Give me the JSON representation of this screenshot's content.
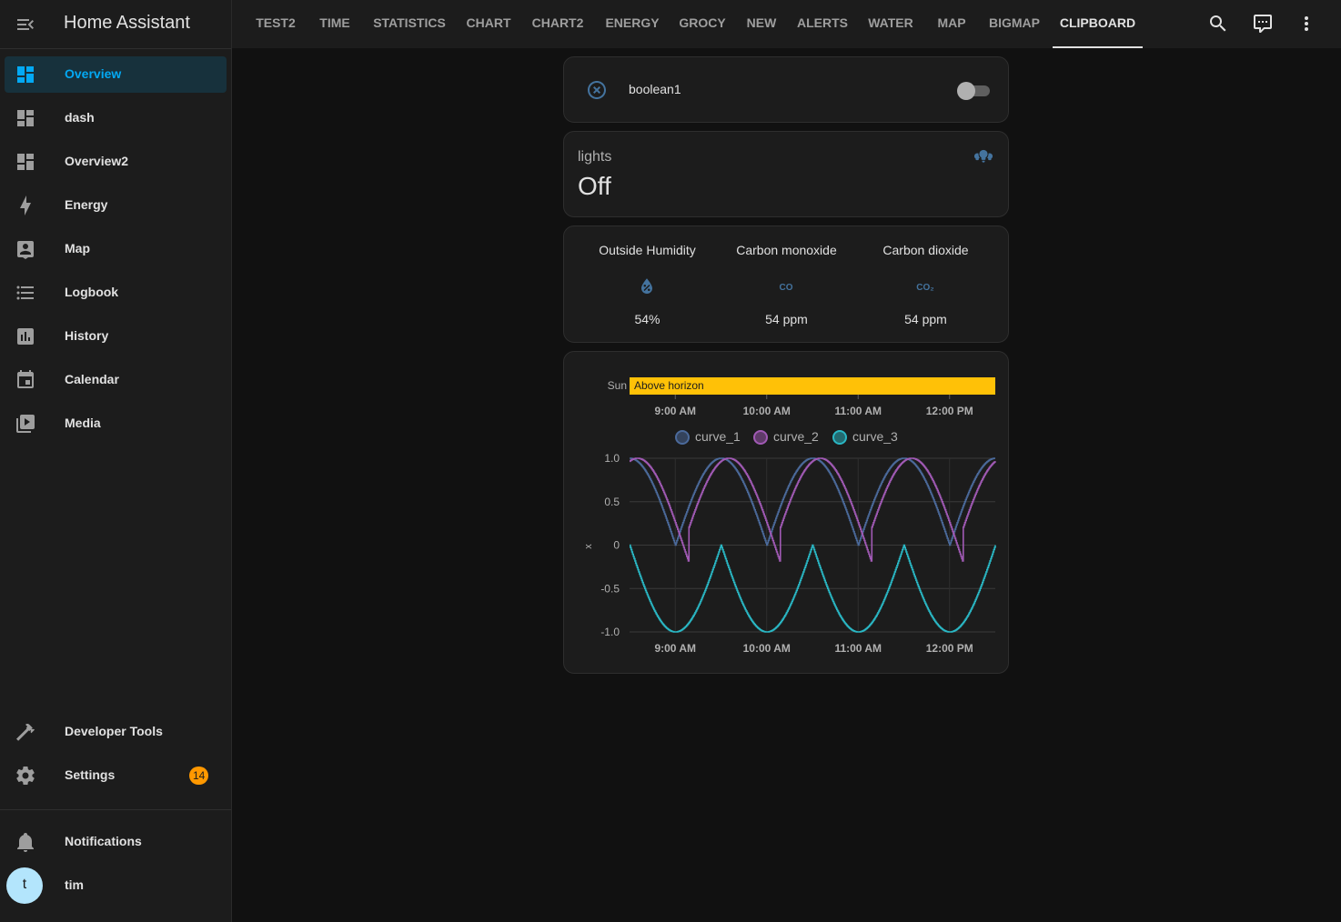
{
  "app": {
    "title": "Home Assistant"
  },
  "sidebar": {
    "items": [
      {
        "label": "Overview",
        "icon": "view-dashboard-icon",
        "active": true
      },
      {
        "label": "dash",
        "icon": "view-dashboard-icon"
      },
      {
        "label": "Overview2",
        "icon": "view-dashboard-icon"
      },
      {
        "label": "Energy",
        "icon": "lightning-bolt-icon"
      },
      {
        "label": "Map",
        "icon": "account-box-icon"
      },
      {
        "label": "Logbook",
        "icon": "format-list-bulleted-icon"
      },
      {
        "label": "History",
        "icon": "chart-box-icon"
      },
      {
        "label": "Calendar",
        "icon": "calendar-icon"
      },
      {
        "label": "Media",
        "icon": "play-box-multiple-icon"
      }
    ],
    "developer_tools": "Developer Tools",
    "settings": "Settings",
    "settings_badge": "14",
    "notifications": "Notifications",
    "user": {
      "name": "tim",
      "initial": "t"
    }
  },
  "topbar": {
    "tabs": [
      "TEST2",
      "TIME",
      "STATISTICS",
      "CHART",
      "CHART2",
      "ENERGY",
      "GROCY",
      "NEW",
      "ALERTS",
      "WATER",
      "MAP",
      "BIGMAP",
      "CLIPBOARD"
    ],
    "active_tab": "CLIPBOARD",
    "icons": [
      "magnify-icon",
      "comment-processing-icon",
      "dots-vertical-icon"
    ]
  },
  "cards": {
    "entity": {
      "name": "boolean1",
      "state": "off"
    },
    "lights": {
      "name": "lights",
      "state": "Off"
    },
    "glance": [
      {
        "name": "Outside Humidity",
        "icon": "water-percent-icon",
        "value": "54%"
      },
      {
        "name": "Carbon monoxide",
        "icon": "molecule-co-icon",
        "icon_text": "CO",
        "value": "54 ppm"
      },
      {
        "name": "Carbon dioxide",
        "icon": "molecule-co2-icon",
        "icon_text": "CO₂",
        "value": "54 ppm"
      }
    ]
  },
  "chart_data": [
    {
      "type": "timeline",
      "rows": [
        {
          "label": "Sun",
          "segments": [
            {
              "state": "Above horizon",
              "start": "8:30 AM",
              "end": "12:30 PM"
            }
          ]
        }
      ],
      "x_ticks": [
        "9:00 AM",
        "10:00 AM",
        "11:00 AM",
        "12:00 PM"
      ],
      "color": "#ffc107"
    },
    {
      "type": "line",
      "ylabel": "x",
      "x_ticks": [
        "9:00 AM",
        "10:00 AM",
        "11:00 AM",
        "12:00 PM"
      ],
      "x_range": [
        "8:30 AM",
        "12:30 PM"
      ],
      "ylim": [
        -1.0,
        1.0
      ],
      "y_ticks": [
        "1.0",
        "0.5",
        "0",
        "-0.5",
        "-1.0"
      ],
      "grid": true,
      "legend": "top-center",
      "series": [
        {
          "name": "curve_1",
          "color": "#4b6a9b",
          "period_min": 60,
          "description_values": "abs(cos)",
          "min": 0,
          "max": 1
        },
        {
          "name": "curve_2",
          "color": "#a15ab5",
          "period_min": 60,
          "phase_min": -5,
          "min": -0.2,
          "max": 1
        },
        {
          "name": "curve_3",
          "color": "#2ab7c4",
          "period_min": 60,
          "min": -1,
          "max": 1
        }
      ]
    }
  ],
  "colors": {
    "accent": "#03a9f4",
    "icon_blue": "#44739e",
    "badge": "#ff9800",
    "background": "#111111",
    "card": "#1c1c1c"
  }
}
